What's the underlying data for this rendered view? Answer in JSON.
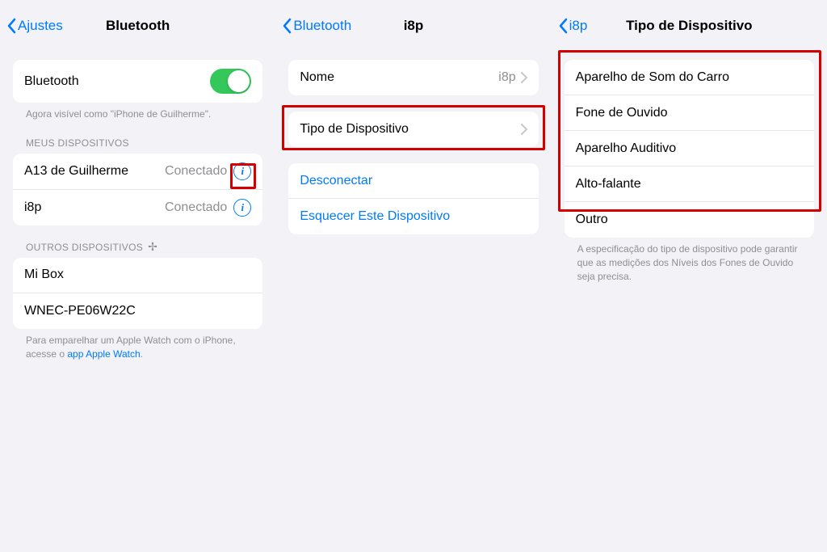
{
  "panel1": {
    "back": "Ajustes",
    "title": "Bluetooth",
    "toggle_label": "Bluetooth",
    "visible_text": "Agora visível como \"iPhone de Guilherme\".",
    "my_devices_header": "MEUS DISPOSITIVOS",
    "devices": [
      {
        "name": "A13 de Guilherme",
        "status": "Conectado"
      },
      {
        "name": "i8p",
        "status": "Conectado"
      }
    ],
    "other_devices_header": "OUTROS DISPOSITIVOS",
    "other_devices": [
      {
        "name": "Mi Box"
      },
      {
        "name": "WNEC-PE06W22C"
      }
    ],
    "footer_prefix": "Para emparelhar um Apple Watch com o iPhone, acesse o ",
    "footer_link": "app Apple Watch",
    "footer_suffix": "."
  },
  "panel2": {
    "back": "Bluetooth",
    "title": "i8p",
    "name_label": "Nome",
    "name_value": "i8p",
    "type_label": "Tipo de Dispositivo",
    "disconnect": "Desconectar",
    "forget": "Esquecer Este Dispositivo"
  },
  "panel3": {
    "back": "i8p",
    "title": "Tipo de Dispositivo",
    "options": [
      "Aparelho de Som do Carro",
      "Fone de Ouvido",
      "Aparelho Auditivo",
      "Alto-falante",
      "Outro"
    ],
    "footer": "A especificação do tipo de dispositivo pode garantir que as medições dos Níveis dos Fones de Ouvido seja precisa."
  }
}
